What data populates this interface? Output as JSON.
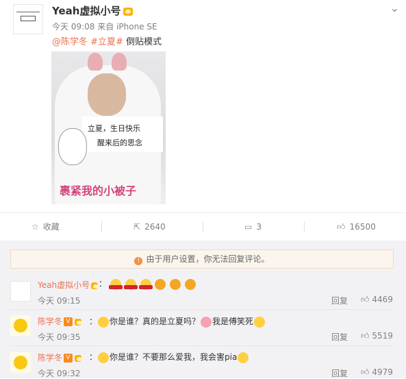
{
  "post": {
    "username": "Yeah虚拟小号",
    "timestamp": "今天 09:08",
    "source_prefix": "来自",
    "source_device": "iPhone SE",
    "mention": "@陈学冬",
    "hashtag": "#立夏#",
    "text": "倒贴模式",
    "image": {
      "caption_line1": "立夏，生日快乐",
      "caption_line2": "醒来后的思念",
      "big_caption": "裹紧我的小被子"
    }
  },
  "actions": {
    "favorite_label": "收藏",
    "repost_count": "2640",
    "comment_count": "3",
    "like_count": "16500"
  },
  "notice": "由于用户设置，你无法回复评论。",
  "comments": [
    {
      "name": "Yeah虚拟小号",
      "separator": "：",
      "text": "",
      "time": "今天 09:15",
      "reply": "回复",
      "likes": "4469"
    },
    {
      "name": "陈学冬",
      "separator": "：",
      "text": "你是谁？真的是立夏吗？",
      "text2": "我是傅笑死",
      "time": "今天 09:35",
      "reply": "回复",
      "likes": "5519"
    },
    {
      "name": "陈学冬",
      "separator": "：",
      "text": "你是谁？不要那么爱我，我会害pia",
      "time": "今天 09:32",
      "reply": "回复",
      "likes": "4979"
    }
  ],
  "badge_v": "V"
}
